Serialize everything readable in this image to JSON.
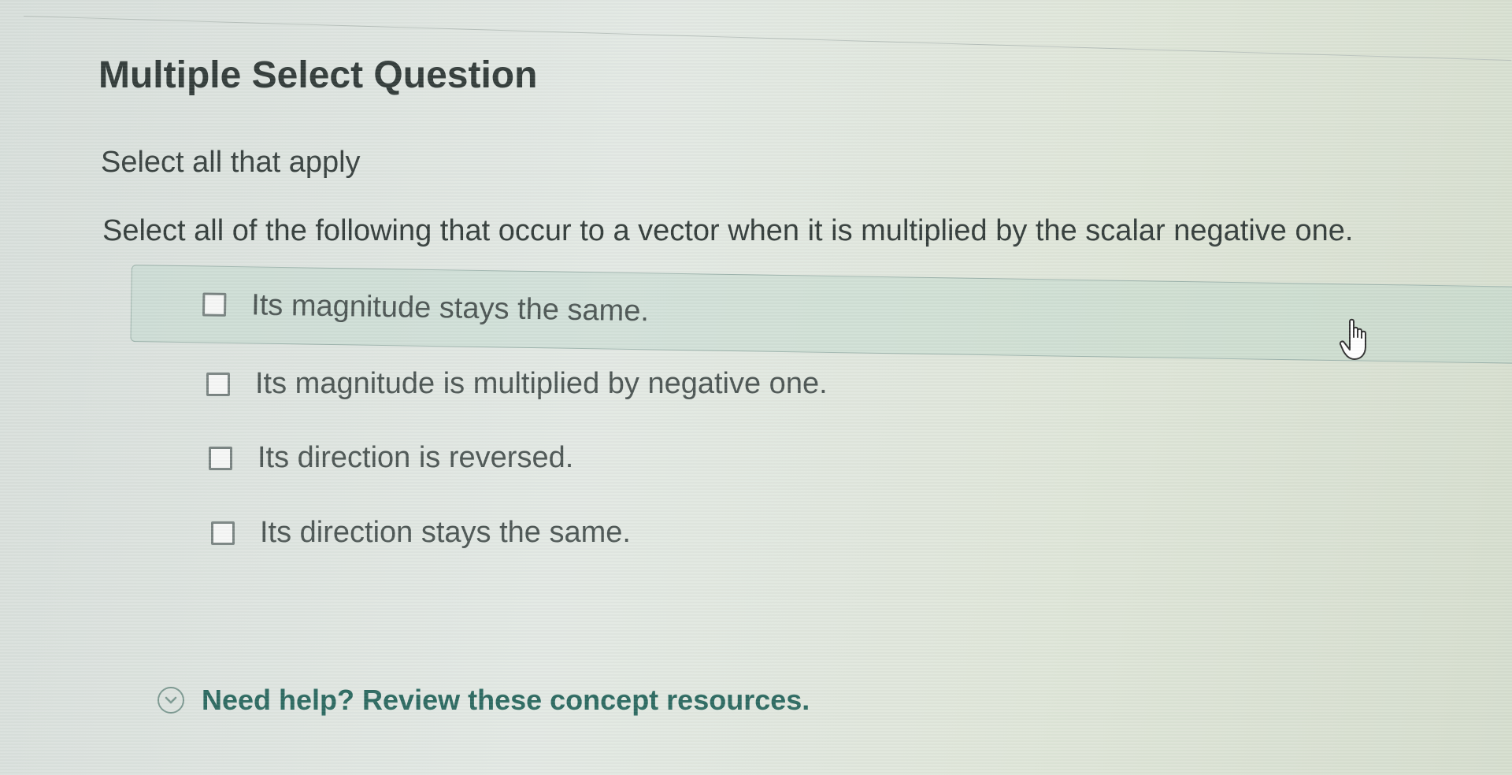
{
  "question": {
    "heading": "Multiple Select Question",
    "instructions": "Select all that apply",
    "prompt": "Select all of the following that occur to a vector when it is multiplied by the scalar negative one.",
    "options": [
      {
        "label": "Its magnitude stays the same.",
        "checked": false
      },
      {
        "label": "Its magnitude is multiplied by negative one.",
        "checked": false
      },
      {
        "label": "Its direction is reversed.",
        "checked": false
      },
      {
        "label": "Its direction stays the same.",
        "checked": false
      }
    ]
  },
  "help": {
    "label": "Need help? Review these concept resources.",
    "icon": "chevron-down-circle-icon"
  },
  "colors": {
    "accent": "#2e6b62",
    "highlight_bg": "#bed6cd",
    "text": "#343d3b"
  }
}
